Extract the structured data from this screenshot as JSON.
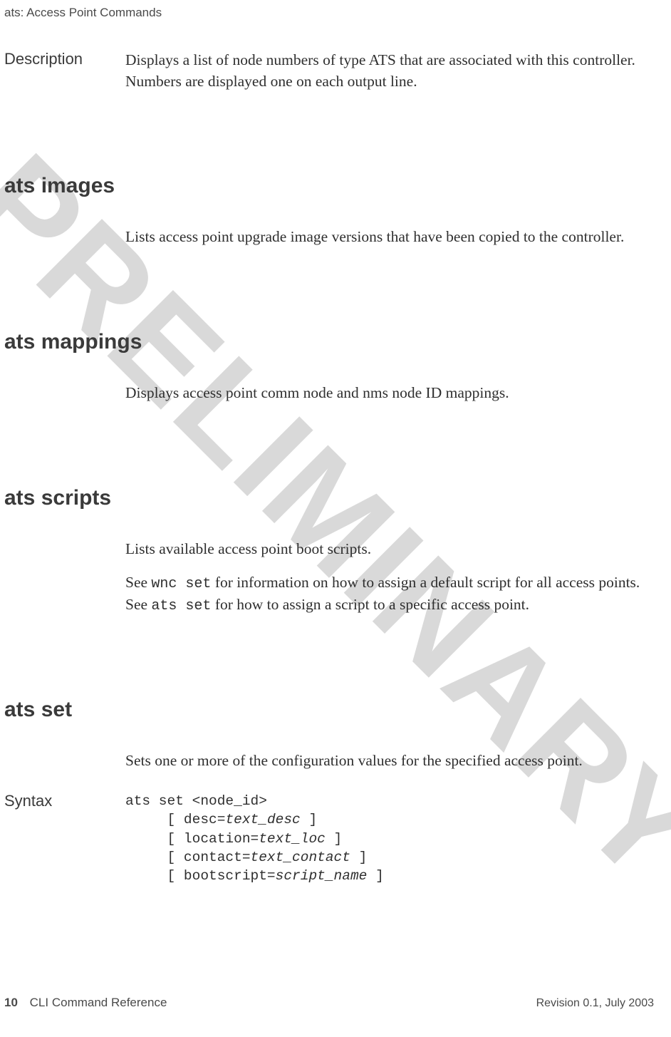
{
  "header": {
    "running": "ats: Access Point Commands"
  },
  "watermark": "PRELIMINARY",
  "desc_block": {
    "label": "Description",
    "text": "Displays a list of node numbers of type ATS that are associated with this controller. Numbers are displayed one on each output line."
  },
  "sections": {
    "images": {
      "title": "ats images",
      "text": "Lists access point upgrade image versions that have been copied to the controller."
    },
    "mappings": {
      "title": "ats mappings",
      "text": "Displays access point comm node and nms node ID mappings."
    },
    "scripts": {
      "title": "ats scripts",
      "para1": "Lists available access point boot scripts.",
      "see_pre1": "See ",
      "code1": "wnc set",
      "see_mid1": " for information on how to assign a default script for all access points. See ",
      "code2": "ats set",
      "see_post1": " for how to assign a script to a specific access point."
    },
    "set": {
      "title": "ats set",
      "text": "Sets one or more of the configuration values for the specified access point."
    }
  },
  "syntax": {
    "label": "Syntax",
    "l1a": "ats set <node_id>",
    "l2a": "     [ desc=",
    "l2b": "text_desc",
    "l2c": " ]",
    "l3a": "     [ location=",
    "l3b": "text_loc",
    "l3c": " ]",
    "l4a": "     [ contact=",
    "l4b": "text_contact",
    "l4c": " ]",
    "l5a": "     [ bootscript=",
    "l5b": "script_name",
    "l5c": " ]"
  },
  "footer": {
    "page_number": "10",
    "doc_title": "CLI Command Reference",
    "revision": "Revision 0.1, July 2003"
  }
}
